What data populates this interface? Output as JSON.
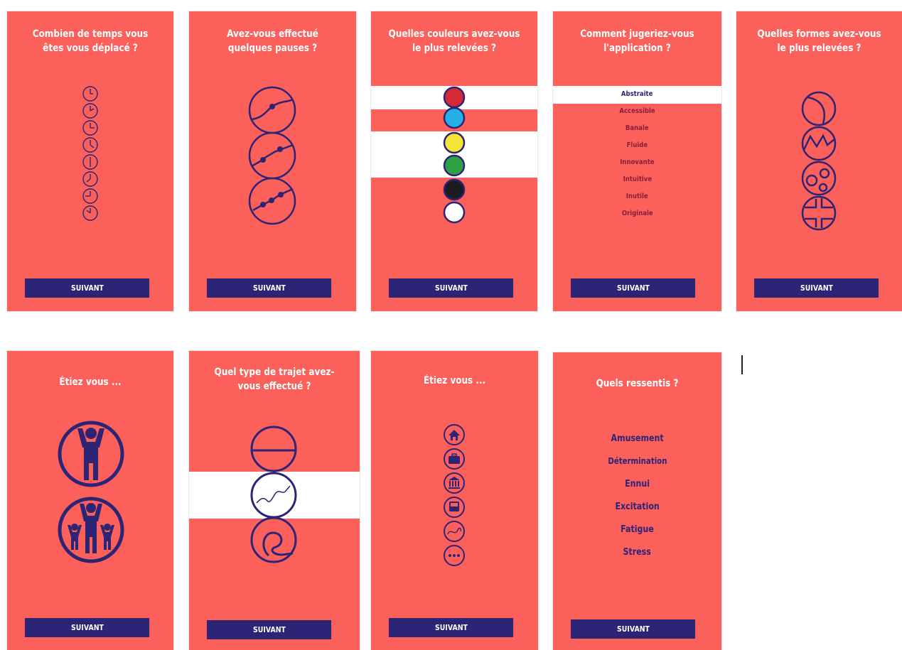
{
  "colors": {
    "background": "#fb605b",
    "accent": "#2d2475",
    "white": "#ffffff"
  },
  "screens": [
    {
      "title": "Combien de temps vous êtes vous déplacé ?",
      "button": "SUIVANT",
      "icons": [
        "clock-1-icon",
        "clock-2-icon",
        "clock-3-icon",
        "clock-4-icon",
        "clock-5-icon",
        "clock-6-icon",
        "clock-7-icon",
        "clock-8-icon"
      ]
    },
    {
      "title": "Avez-vous effectué quelques pauses ?",
      "button": "SUIVANT",
      "icons": [
        "one-pause-icon",
        "two-pauses-icon",
        "three-pauses-icon"
      ]
    },
    {
      "title": "Quelles couleurs avez-vous le plus relevées ?",
      "button": "SUIVANT",
      "colors": [
        "#d42a35",
        "#27aee7",
        "#f6e536",
        "#2fa043",
        "#1c1b22",
        "#ffffff"
      ]
    },
    {
      "title": "Comment jugeriez-vous l'application ?",
      "button": "SUIVANT",
      "options": [
        "Abstraite",
        "Accessible",
        "Banale",
        "Fluide",
        "Innovante",
        "Intuitive",
        "Inutile",
        "Originale"
      ],
      "selected": "Abstraite"
    },
    {
      "title": "Quelles formes avez-vous le plus relevées ?",
      "button": "SUIVANT",
      "icons": [
        "curve-shape-icon",
        "zigzag-shape-icon",
        "circles-shape-icon",
        "square-shape-icon"
      ]
    },
    {
      "title": "Étiez vous ...",
      "button": "SUIVANT",
      "icons": [
        "alone-person-icon",
        "family-group-icon"
      ]
    },
    {
      "title": "Quel type de trajet avez-vous effectué ?",
      "button": "SUIVANT",
      "icons": [
        "straight-route-icon",
        "wavy-route-icon",
        "loop-route-icon"
      ]
    },
    {
      "title": "Étiez vous ...",
      "button": "SUIVANT",
      "icons": [
        "home-icon",
        "briefcase-icon",
        "museum-icon",
        "bus-icon",
        "leisure-icon",
        "more-icon"
      ]
    },
    {
      "title": "Quels ressentis ?",
      "button": "SUIVANT",
      "options": [
        "Amusement",
        "Détermination",
        "Ennui",
        "Excitation",
        "Fatigue",
        "Stress"
      ]
    }
  ]
}
